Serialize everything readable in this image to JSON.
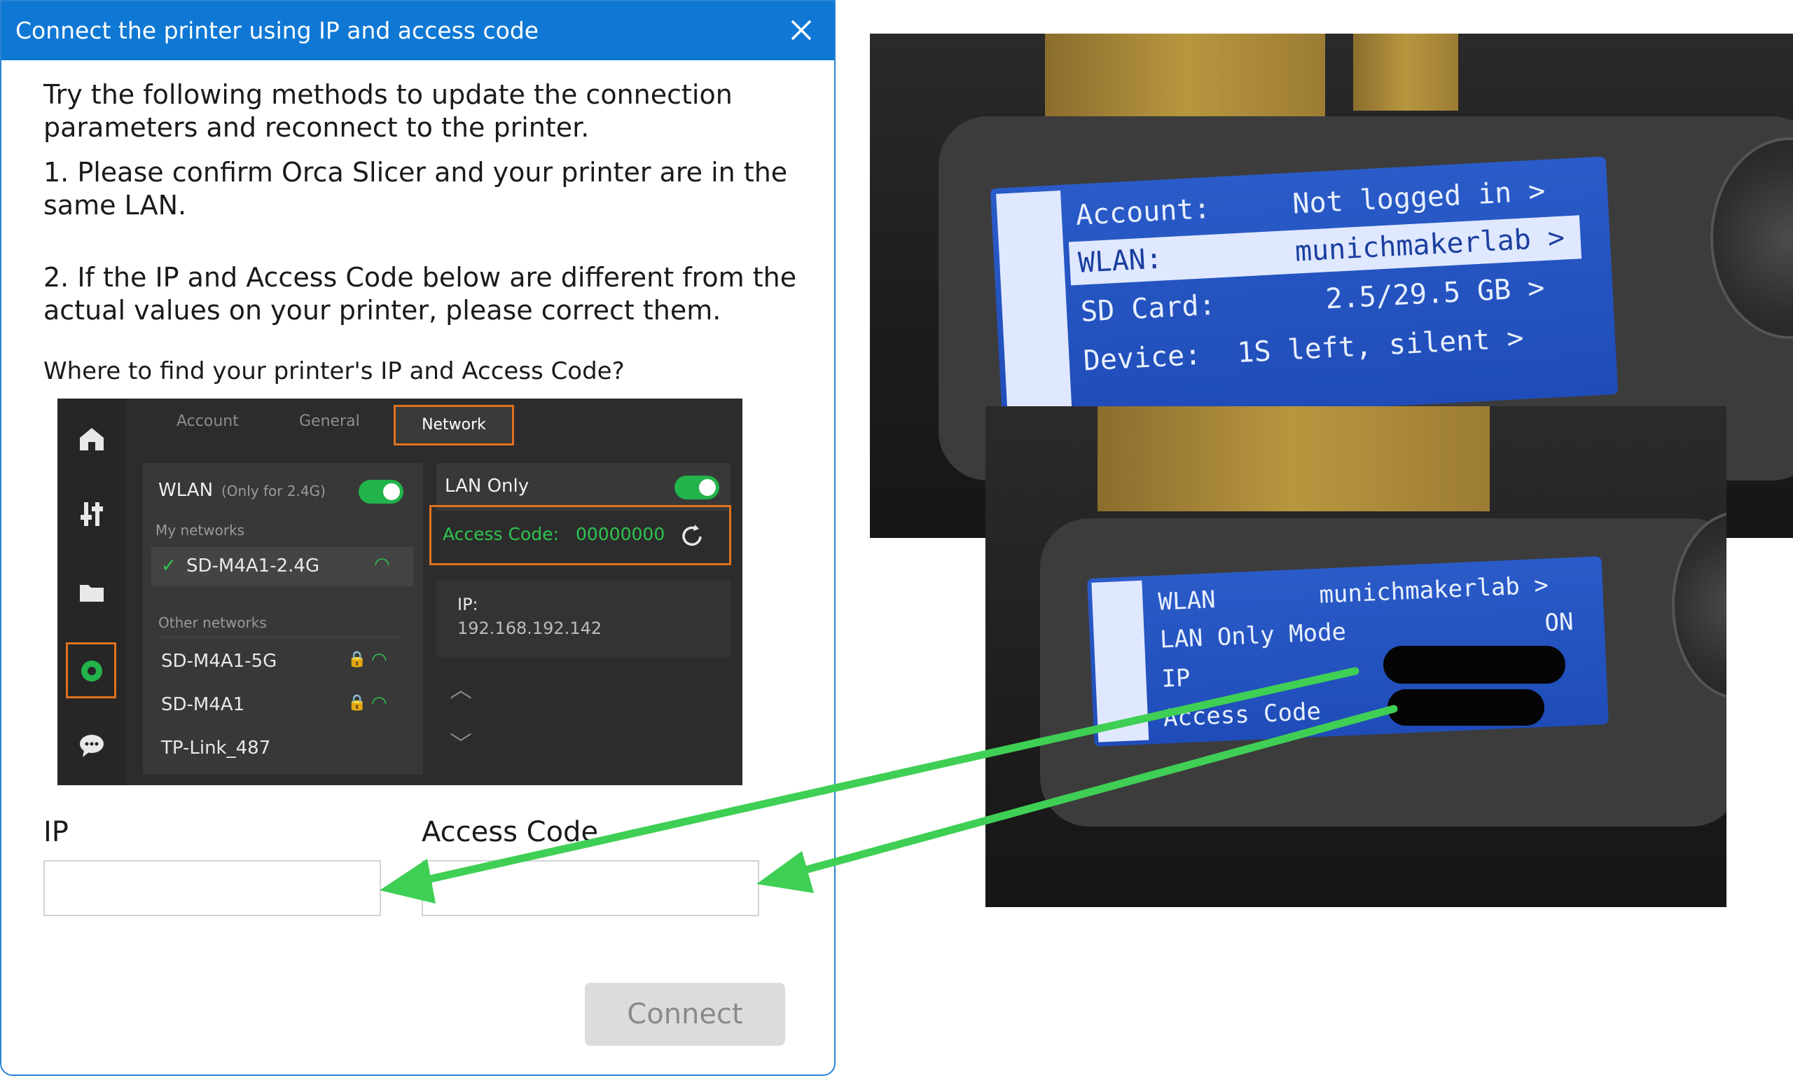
{
  "dialog": {
    "title": "Connect the printer using IP and access code",
    "intro": "Try the following methods to update the connection parameters and reconnect to the printer.",
    "step1": "1. Please confirm Orca Slicer and your printer are in the same LAN.",
    "step2": "2. If the IP and Access Code below are different from the actual values on your printer, please correct them.",
    "help_link": "Where to find your printer's IP and Access Code?",
    "ip_label": "IP",
    "access_code_label": "Access Code",
    "ip_value": "",
    "access_code_value": "",
    "connect_label": "Connect"
  },
  "mini_ui": {
    "tabs": [
      "Account",
      "General",
      "Network"
    ],
    "wlan_label": "WLAN",
    "wlan_note": "(Only for 2.4G)",
    "my_networks": "My networks",
    "current_network": "SD-M4A1-2.4G",
    "other_networks_label": "Other networks",
    "other_networks": [
      "SD-M4A1-5G",
      "SD-M4A1",
      "TP-Link_487"
    ],
    "lan_only": "LAN Only",
    "access_code_label": "Access Code:",
    "access_code_value": "00000000",
    "ip_label": "IP:",
    "ip_value": "192.168.192.142"
  },
  "photo_top": {
    "rows": [
      {
        "label": "Account:",
        "value": "Not logged in >"
      },
      {
        "label": "WLAN:",
        "value": "munichmakerlab >"
      },
      {
        "label": "SD Card:",
        "value": "2.5/29.5 GB >"
      },
      {
        "label": "Device:",
        "value": "1S left, silent >"
      }
    ]
  },
  "photo_bottom": {
    "rows": [
      {
        "label": "WLAN",
        "value": "munichmakerlab >"
      },
      {
        "label": "LAN Only Mode",
        "value": "ON"
      },
      {
        "label": "IP",
        "value": ""
      },
      {
        "label": "Access Code",
        "value": ""
      }
    ]
  },
  "colors": {
    "title_bar": "#0f78d4",
    "accent_orange": "#e0721f",
    "toggle_green": "#22b34a",
    "arrow_green": "#3fcf55",
    "lcd_blue": "#2a5bc8"
  }
}
